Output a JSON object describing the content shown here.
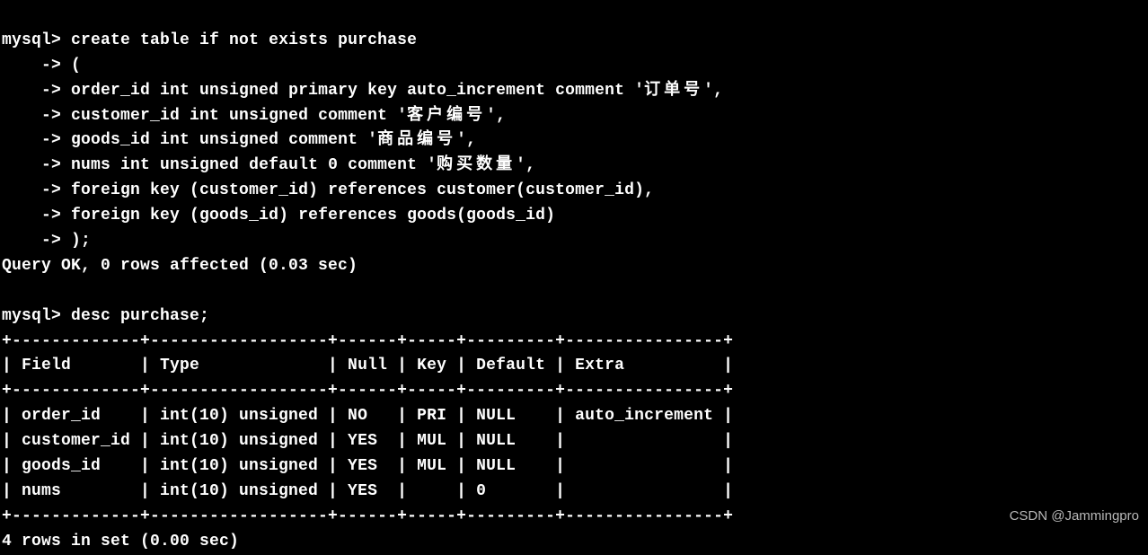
{
  "terminal": {
    "prompt1": "mysql>",
    "cont_prompt": "    ->",
    "create_lines": [
      "create table if not exists purchase",
      "(",
      "order_id int unsigned primary key auto_increment comment '订单号',",
      "customer_id int unsigned comment '客户编号',",
      "goods_id int unsigned comment '商品编号',",
      "nums int unsigned default 0 comment '购买数量',",
      "foreign key (customer_id) references customer(customer_id),",
      "foreign key (goods_id) references goods(goods_id)",
      ");"
    ],
    "query_ok": "Query OK, 0 rows affected (0.03 sec)",
    "desc_cmd": "desc purchase;",
    "table_border": "+-------------+------------------+------+-----+---------+----------------+",
    "table_header": "| Field       | Type             | Null | Key | Default | Extra          |",
    "rows": [
      "| order_id    | int(10) unsigned | NO   | PRI | NULL    | auto_increment |",
      "| customer_id | int(10) unsigned | YES  | MUL | NULL    |                |",
      "| goods_id    | int(10) unsigned | YES  | MUL | NULL    |                |",
      "| nums        | int(10) unsigned | YES  |     | 0       |                |"
    ],
    "rows_in_set": "4 rows in set (0.00 sec)"
  },
  "chart_data": {
    "type": "table",
    "title": "desc purchase",
    "columns": [
      "Field",
      "Type",
      "Null",
      "Key",
      "Default",
      "Extra"
    ],
    "data": [
      [
        "order_id",
        "int(10) unsigned",
        "NO",
        "PRI",
        "NULL",
        "auto_increment"
      ],
      [
        "customer_id",
        "int(10) unsigned",
        "YES",
        "MUL",
        "NULL",
        ""
      ],
      [
        "goods_id",
        "int(10) unsigned",
        "YES",
        "MUL",
        "NULL",
        ""
      ],
      [
        "nums",
        "int(10) unsigned",
        "YES",
        "",
        "0",
        ""
      ]
    ]
  },
  "watermark": "CSDN @Jammingpro"
}
